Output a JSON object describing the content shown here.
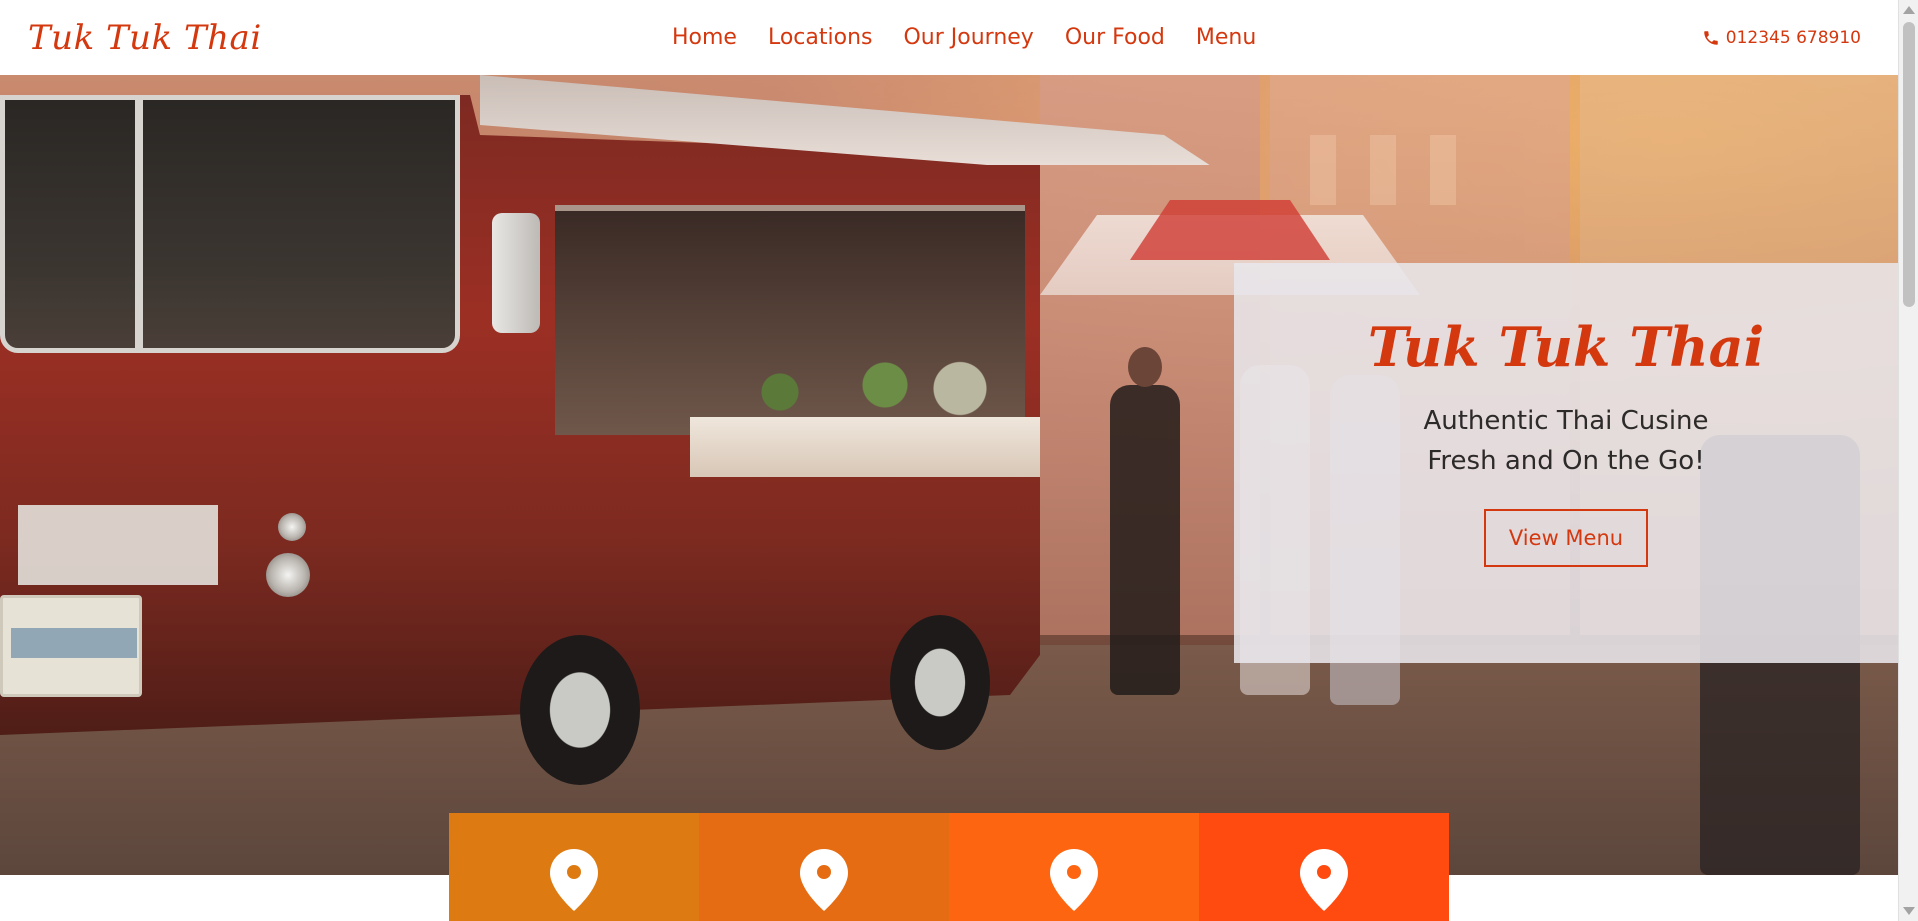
{
  "header": {
    "brand": "Tuk Tuk Thai",
    "nav": [
      "Home",
      "Locations",
      "Our Journey",
      "Our Food",
      "Menu"
    ],
    "phone": "012345 678910",
    "phone_icon": "phone-icon",
    "accent_color": "#d4380f"
  },
  "hero": {
    "title": "Tuk Tuk Thai",
    "subtitle_line1": "Authentic Thai Cusine",
    "subtitle_line2": "Fresh and On the Go!",
    "button_label": "View Menu"
  },
  "locations": {
    "tiles": [
      {
        "icon": "map-pin-icon",
        "color": "#dd7b12"
      },
      {
        "icon": "map-pin-icon",
        "color": "#e56c12"
      },
      {
        "icon": "map-pin-icon",
        "color": "#fe6510"
      },
      {
        "icon": "map-pin-icon",
        "color": "#ff4a10"
      }
    ]
  }
}
